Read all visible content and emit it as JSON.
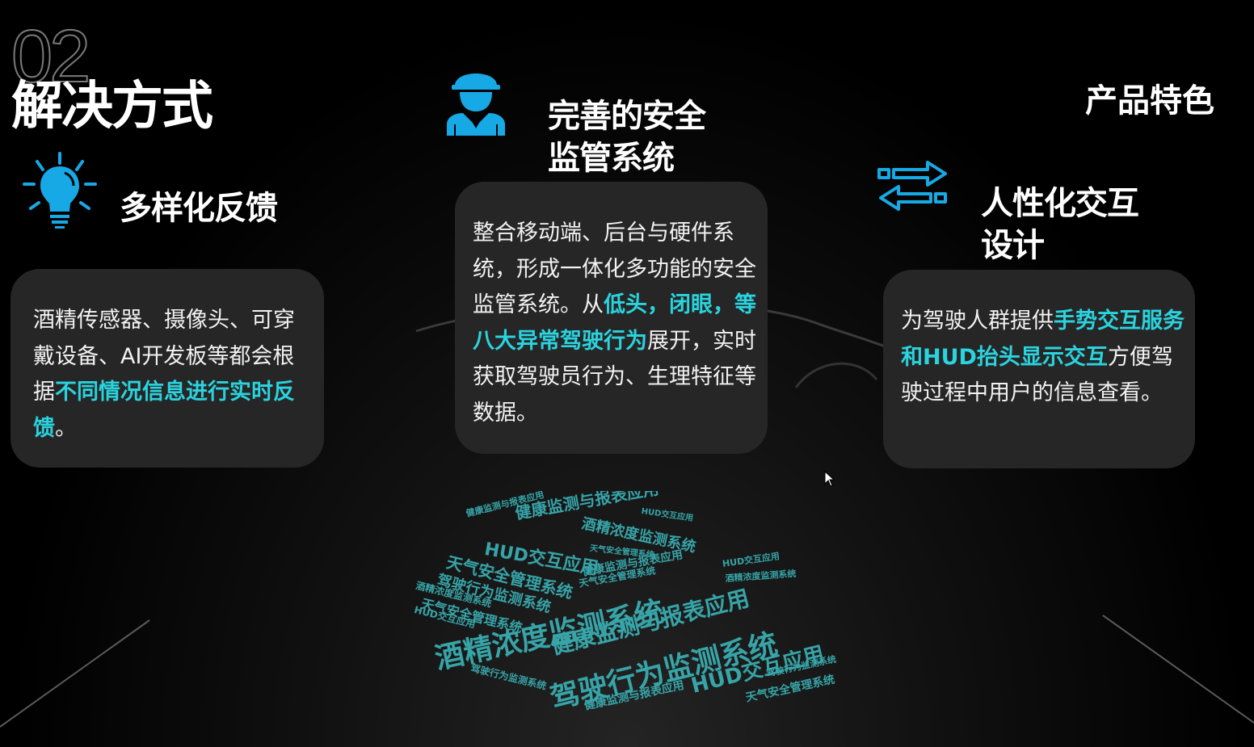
{
  "header": {
    "section_number": "02",
    "section_title": "解决方式",
    "product_feature": "产品特色"
  },
  "features": [
    {
      "title": "多样化反馈",
      "icon": "lightbulb-icon",
      "desc_parts": [
        "酒精传感器、摄像头、可穿戴设备、AI开发板等都会根据",
        "不同情况信息进行实时反馈",
        "。"
      ]
    },
    {
      "title_line1": "完善的安全",
      "title_line2": "监管系统",
      "icon": "worker-icon",
      "desc_parts": [
        "整合移动端、后台与硬件系统，形成一体化多功能的安全监管系统。从",
        "低头，闭眼，等八大异常驾驶行为",
        "展开，实时获取驾驶员行为、生理特征等数据。"
      ]
    },
    {
      "title_line1": "人性化交互",
      "title_line2": "设计",
      "icon": "swap-arrows-icon",
      "desc_parts": [
        "为驾驶人群提供",
        "手势交互服务和HUD抬头显示交互",
        "方便驾驶过程中用户的信息查看。"
      ]
    }
  ],
  "word_cloud": [
    "健康监测与报表应用",
    "酒精浓度监测系统",
    "HUD交互应用",
    "天气安全管理系统",
    "驾驶行为监测系统",
    "酒精浓度监测系统",
    "健康监测与报表应用",
    "驾驶行为监测系统",
    "HUD交互应用",
    "天气安全管理系统",
    "健康监测与报表应用",
    "天气安全管理系统",
    "酒精浓度监测系统",
    "HUD交互应用",
    "驾驶行为监测系统",
    "健康监测与报表应用",
    "天气安全管理系统",
    "HUD交互应用",
    "驾驶行为监测系统",
    "酒精浓度监测系统",
    "健康监测与报表应用",
    "HUD交互应用",
    "天气安全管理系统"
  ],
  "colors": {
    "accent": "#2ad3de",
    "icon": "#17a9e6",
    "card": "#262626"
  }
}
